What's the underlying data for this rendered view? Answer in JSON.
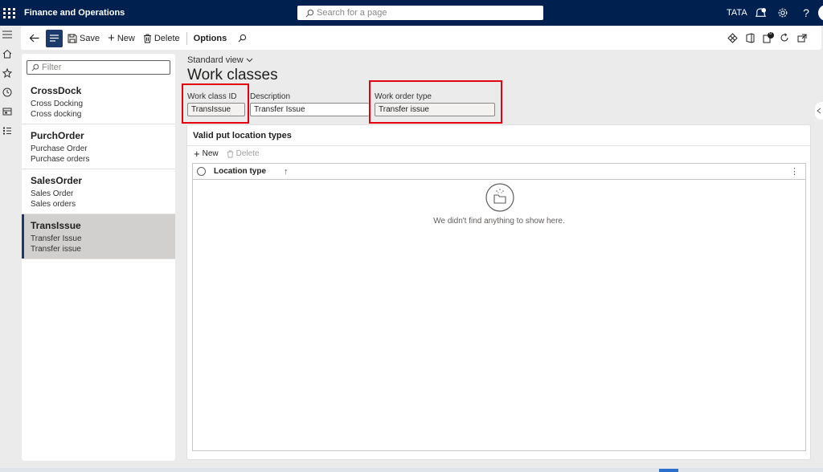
{
  "app": {
    "title": "Finance and Operations",
    "company": "TATA"
  },
  "search": {
    "placeholder": "Search for a page"
  },
  "topbar_icons": [
    "waffle-icon",
    "notifications-icon",
    "settings-gear-icon",
    "help-icon"
  ],
  "notification_count": "1",
  "actionpane": {
    "save_label": "Save",
    "new_label": "New",
    "delete_label": "Delete",
    "options_label": "Options",
    "attach_count": "0"
  },
  "filter": {
    "placeholder": "Filter"
  },
  "list": [
    {
      "title": "CrossDock",
      "line1": "Cross Docking",
      "line2": "Cross docking"
    },
    {
      "title": "PurchOrder",
      "line1": "Purchase Order",
      "line2": "Purchase orders"
    },
    {
      "title": "SalesOrder",
      "line1": "Sales Order",
      "line2": "Sales orders"
    },
    {
      "title": "TransIssue",
      "line1": "Transfer Issue",
      "line2": "Transfer issue"
    }
  ],
  "view": {
    "label": "Standard view"
  },
  "page": {
    "title": "Work classes"
  },
  "fields": {
    "work_class_id": {
      "label": "Work class ID",
      "value": "TransIssue"
    },
    "description": {
      "label": "Description",
      "value": "Transfer Issue"
    },
    "work_order_type": {
      "label": "Work order type",
      "value": "Transfer issue"
    }
  },
  "section": {
    "title": "Valid put location types",
    "new_label": "New",
    "delete_label": "Delete",
    "column": "Location type",
    "empty_text": "We didn't find anything to show here."
  },
  "colors": {
    "nav": "#002050",
    "accent": "#1c3a6b",
    "highlight": "#e3000f"
  }
}
